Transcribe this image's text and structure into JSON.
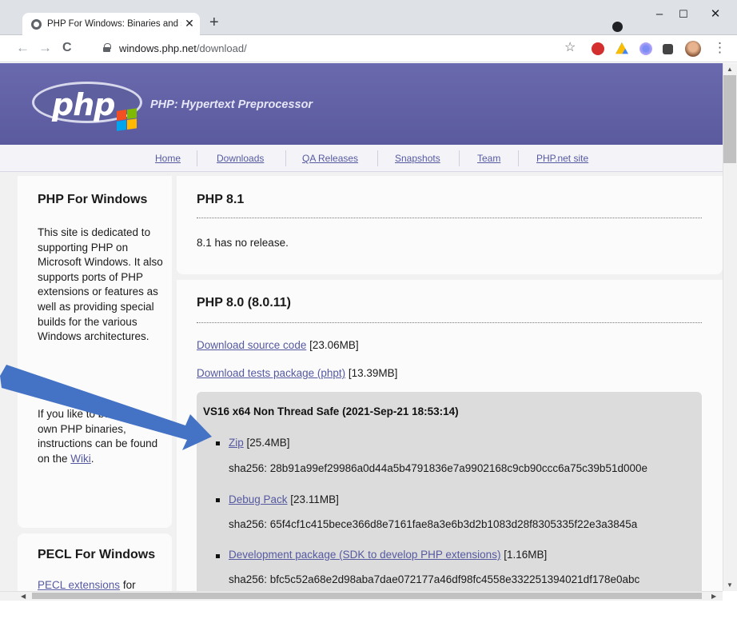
{
  "browser": {
    "tab_title": "PHP For Windows: Binaries and s",
    "tab_close": "✕",
    "new_tab": "+",
    "url_host": "windows.php.net",
    "url_path": "/download/",
    "back_icon": "←",
    "forward_icon": "→",
    "reload_icon": "C",
    "star_icon": "☆",
    "menu_icon": "⋮",
    "extensions": [
      "adblock-icon",
      "drive-icon",
      "extension-flower-icon",
      "puzzle-icon",
      "avatar"
    ],
    "window_controls": {
      "minimize": "–",
      "maximize": "☐",
      "close": "✕"
    }
  },
  "header": {
    "logo_text": "php",
    "tagline": "PHP: Hypertext Preprocessor"
  },
  "nav": {
    "links": [
      "Home",
      "Downloads",
      "QA Releases",
      "Snapshots",
      "Team",
      "PHP.net site"
    ]
  },
  "sidebar": {
    "box1": {
      "title": "PHP For Windows",
      "text1": "This site is dedicated to supporting PHP on Microsoft Windows. It also supports ports of PHP extensions or features as well as providing special builds for the various Windows architectures.",
      "text2_pre": "If you like to build your own PHP binaries, instructions can be found on the ",
      "text2_link": "Wiki",
      "text2_post": "."
    },
    "box2": {
      "title": "PECL For Windows",
      "link": "PECL extensions",
      "text_post": " for Windows is being"
    }
  },
  "main": {
    "php81": {
      "title": "PHP 8.1",
      "text": "8.1 has no release."
    },
    "php80": {
      "title": "PHP 8.0 (8.0.11)",
      "source_link": "Download source code",
      "source_size": " [23.06MB]",
      "tests_link": "Download tests package (phpt)",
      "tests_size": " [13.39MB]",
      "build": {
        "title": "VS16 x64 Non Thread Safe (2021-Sep-21 18:53:14)",
        "items": [
          {
            "link": "Zip",
            "size": " [25.4MB]",
            "sha": "sha256: 28b91a99ef29986a0d44a5b4791836e7a9902168c9cb90ccc6a75c39b51d000e"
          },
          {
            "link": "Debug Pack",
            "size": " [23.11MB]",
            "sha": "sha256: 65f4cf1c415bece366d8e7161fae8a3e6b3d2b1083d28f8305335f22e3a3845a"
          },
          {
            "link": "Development package (SDK to develop PHP extensions)",
            "size": " [1.16MB]",
            "sha": "sha256: bfc5c52a68e2d98aba7dae072177a46df98fc4558e332251394021df178e0abc"
          }
        ]
      }
    }
  },
  "colors": {
    "header": "#5b5a9e",
    "link": "#5559a0",
    "annotation_arrow": "#4472c4"
  }
}
